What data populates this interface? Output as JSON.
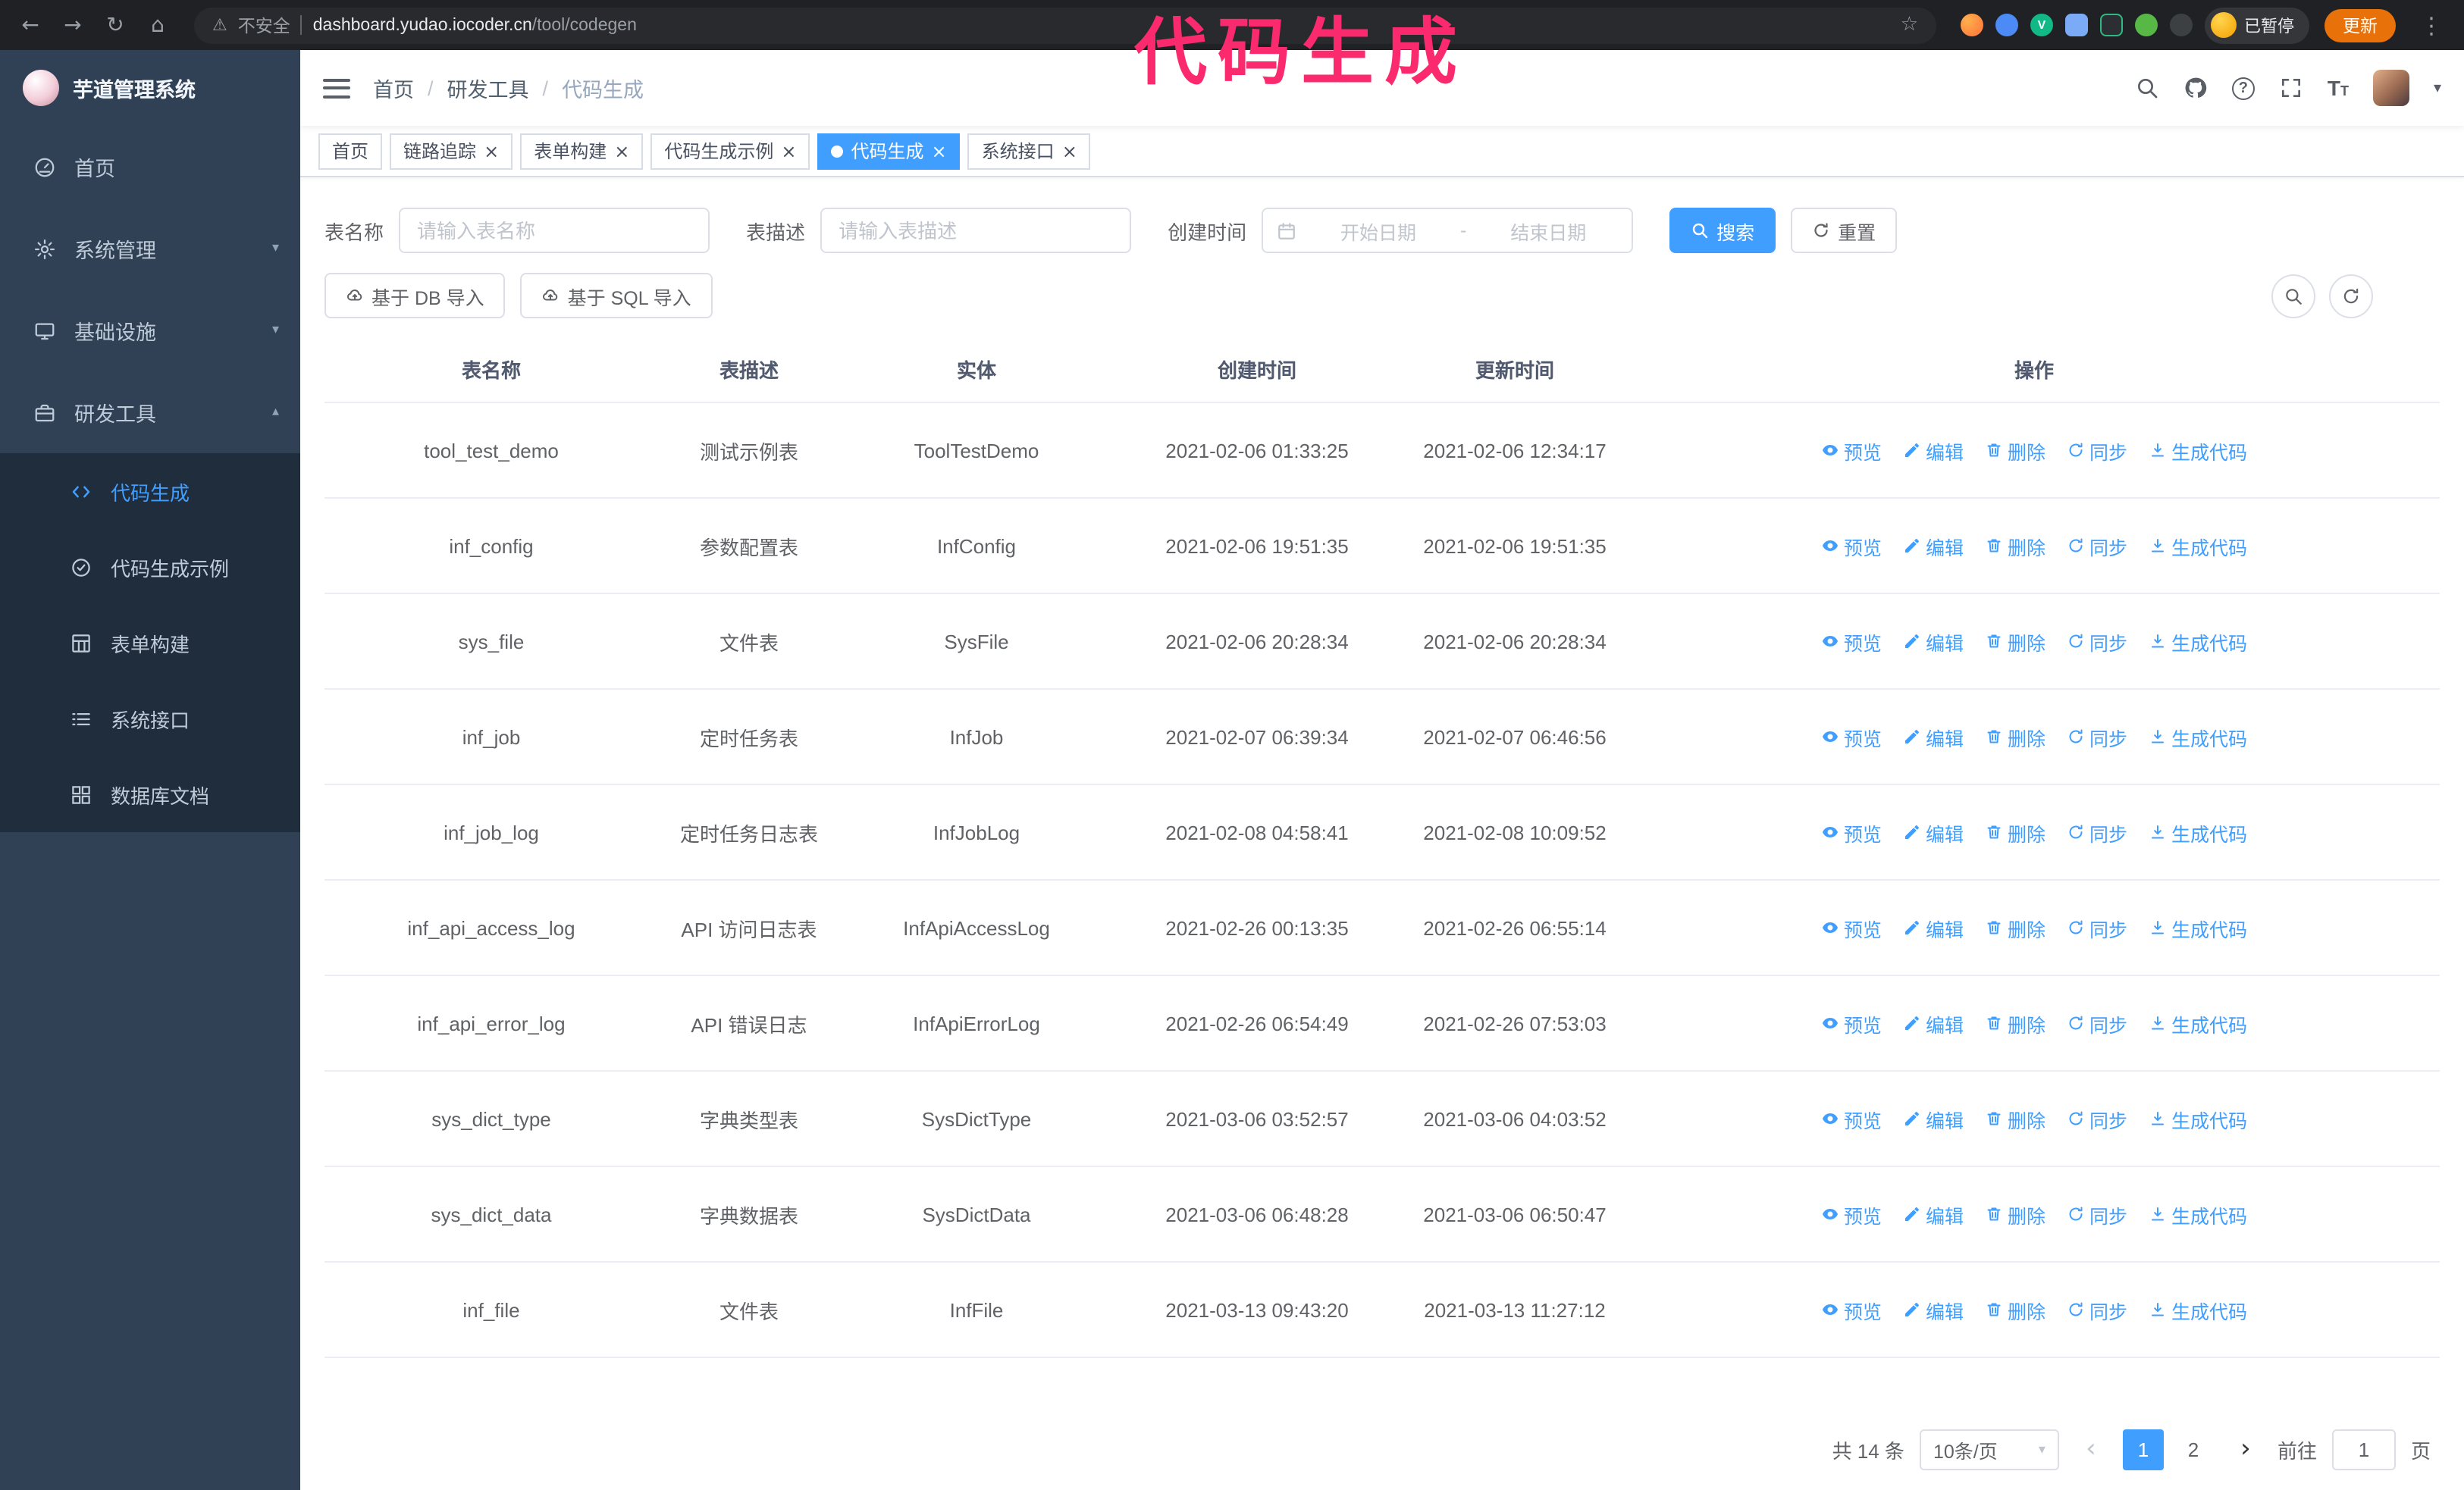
{
  "annotation": "代码生成",
  "colors": {
    "accent": "#409eff",
    "sidebar_bg": "#304156",
    "submenu_bg": "#1f2d3d",
    "annotation_pink": "#fb2a6e"
  },
  "icons": {
    "back": "←",
    "forward": "→",
    "reload": "↻",
    "home": "⌂",
    "warning": "⚠",
    "star": "☆",
    "kebab": "⋮",
    "caret_down": "▾",
    "chevron_down": "▾",
    "chevron_up": "▴",
    "close": "×",
    "prev": "‹",
    "next": "›",
    "question_mark": "?",
    "font_size_large": "T",
    "font_size_small": "T",
    "breadcrumb_separator": "/"
  },
  "browser": {
    "security_label": "不安全",
    "url_domain": "dashboard.yudao.iocoder.cn",
    "url_path": "/tool/codegen",
    "profile_badge": "已暂停",
    "update_button": "更新"
  },
  "sidebar": {
    "logo_title": "芋道管理系统",
    "items": [
      {
        "label": "首页"
      },
      {
        "label": "系统管理"
      },
      {
        "label": "基础设施"
      },
      {
        "label": "研发工具"
      }
    ],
    "sub_items": [
      {
        "label": "代码生成",
        "active": true
      },
      {
        "label": "代码生成示例",
        "active": false
      },
      {
        "label": "表单构建",
        "active": false
      },
      {
        "label": "系统接口",
        "active": false
      },
      {
        "label": "数据库文档",
        "active": false
      }
    ]
  },
  "breadcrumb": [
    "首页",
    "研发工具",
    "代码生成"
  ],
  "tabs": [
    {
      "label": "首页",
      "closable": false,
      "active": false
    },
    {
      "label": "链路追踪",
      "closable": true,
      "active": false
    },
    {
      "label": "表单构建",
      "closable": true,
      "active": false
    },
    {
      "label": "代码生成示例",
      "closable": true,
      "active": false
    },
    {
      "label": "代码生成",
      "closable": true,
      "active": true
    },
    {
      "label": "系统接口",
      "closable": true,
      "active": false
    }
  ],
  "filter": {
    "table_name_label": "表名称",
    "table_name_placeholder": "请输入表名称",
    "table_desc_label": "表描述",
    "table_desc_placeholder": "请输入表描述",
    "create_time_label": "创建时间",
    "date_start_placeholder": "开始日期",
    "date_separator": "-",
    "date_end_placeholder": "结束日期",
    "search_button": "搜索",
    "reset_button": "重置"
  },
  "toolbar": {
    "import_db_button": "基于 DB 导入",
    "import_sql_button": "基于 SQL 导入"
  },
  "table": {
    "columns": [
      "表名称",
      "表描述",
      "实体",
      "创建时间",
      "更新时间",
      "操作"
    ],
    "actions": [
      "预览",
      "编辑",
      "删除",
      "同步",
      "生成代码"
    ],
    "rows": [
      {
        "name": "tool_test_demo",
        "desc": "测试示例表",
        "entity": "ToolTestDemo",
        "created": "2021-02-06 01:33:25",
        "updated": "2021-02-06 12:34:17"
      },
      {
        "name": "inf_config",
        "desc": "参数配置表",
        "entity": "InfConfig",
        "created": "2021-02-06 19:51:35",
        "updated": "2021-02-06 19:51:35"
      },
      {
        "name": "sys_file",
        "desc": "文件表",
        "entity": "SysFile",
        "created": "2021-02-06 20:28:34",
        "updated": "2021-02-06 20:28:34"
      },
      {
        "name": "inf_job",
        "desc": "定时任务表",
        "entity": "InfJob",
        "created": "2021-02-07 06:39:34",
        "updated": "2021-02-07 06:46:56"
      },
      {
        "name": "inf_job_log",
        "desc": "定时任务日志表",
        "entity": "InfJobLog",
        "created": "2021-02-08 04:58:41",
        "updated": "2021-02-08 10:09:52"
      },
      {
        "name": "inf_api_access_log",
        "desc": "API 访问日志表",
        "entity": "InfApiAccessLog",
        "created": "2021-02-26 00:13:35",
        "updated": "2021-02-26 06:55:14"
      },
      {
        "name": "inf_api_error_log",
        "desc": "API 错误日志",
        "entity": "InfApiErrorLog",
        "created": "2021-02-26 06:54:49",
        "updated": "2021-02-26 07:53:03"
      },
      {
        "name": "sys_dict_type",
        "desc": "字典类型表",
        "entity": "SysDictType",
        "created": "2021-03-06 03:52:57",
        "updated": "2021-03-06 04:03:52"
      },
      {
        "name": "sys_dict_data",
        "desc": "字典数据表",
        "entity": "SysDictData",
        "created": "2021-03-06 06:48:28",
        "updated": "2021-03-06 06:50:47"
      },
      {
        "name": "inf_file",
        "desc": "文件表",
        "entity": "InfFile",
        "created": "2021-03-13 09:43:20",
        "updated": "2021-03-13 11:27:12"
      }
    ]
  },
  "pagination": {
    "total_text": "共 14 条",
    "page_size": "10条/页",
    "pages": [
      "1",
      "2"
    ],
    "active_page": "1",
    "goto_label": "前往",
    "goto_value": "1",
    "goto_suffix": "页"
  }
}
